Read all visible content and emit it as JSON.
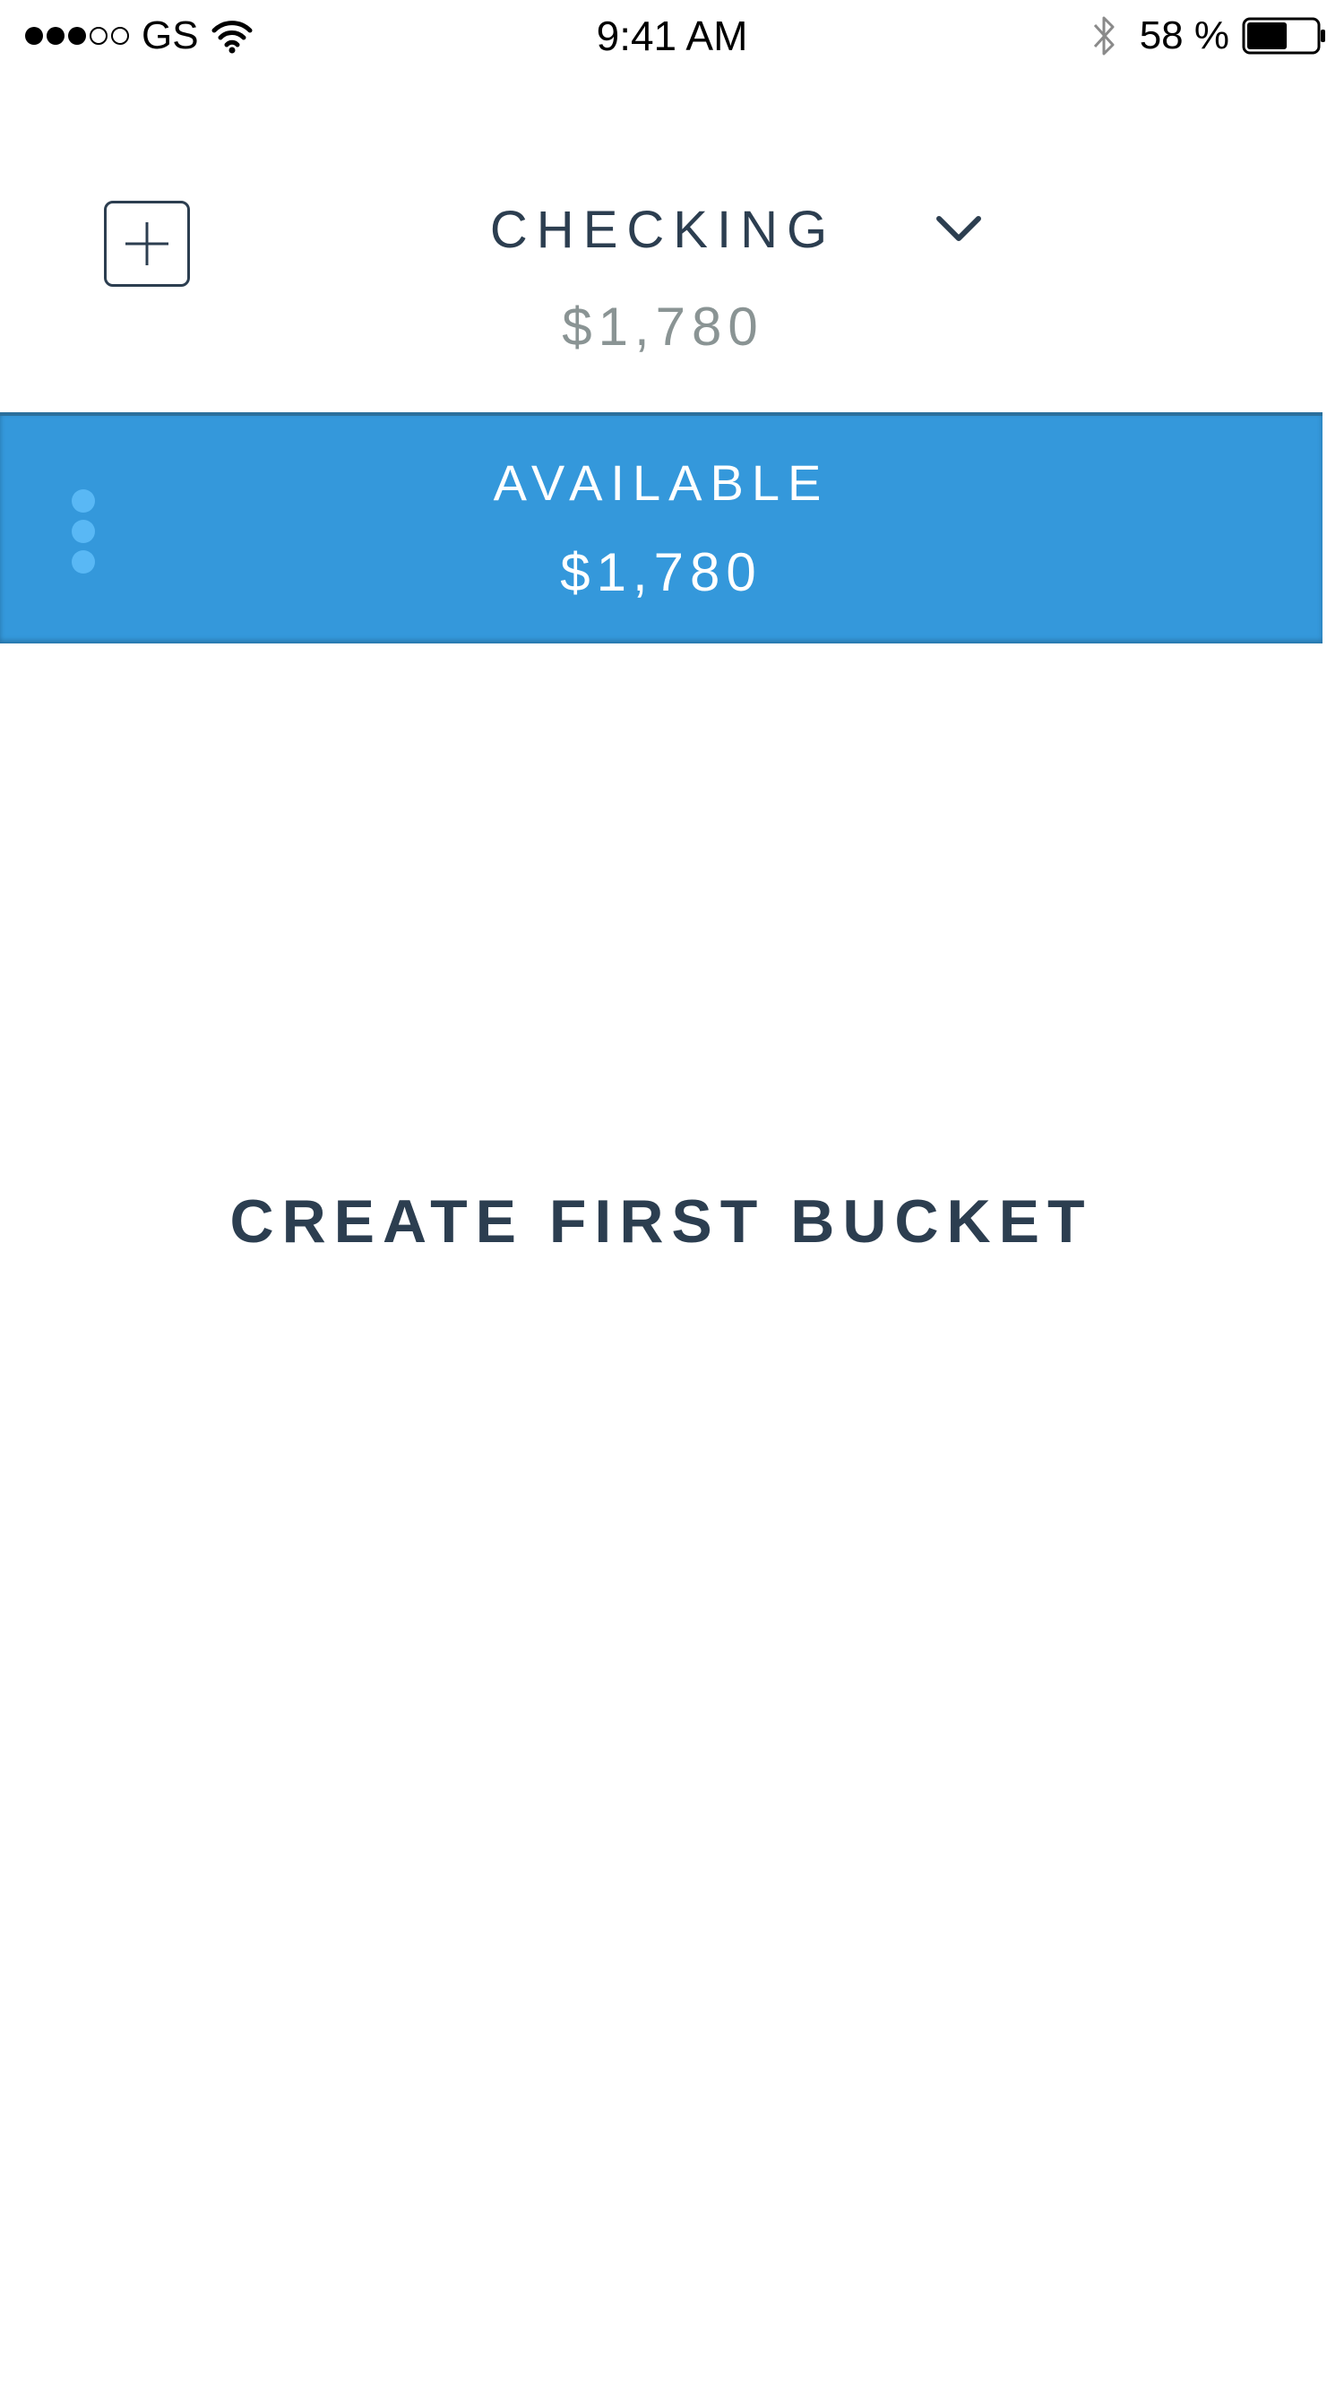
{
  "status_bar": {
    "signal": {
      "filled": 3,
      "total": 5
    },
    "carrier": "GS",
    "time": "9:41 AM",
    "battery_percent": "58 %",
    "battery_level": 0.58,
    "icons": [
      "wifi-icon",
      "bluetooth-icon",
      "battery-icon"
    ]
  },
  "header": {
    "add_icon": "plus-square-icon",
    "account_name": "CHECKING",
    "dropdown_icon": "chevron-down-icon",
    "account_balance": "$1,780"
  },
  "available": {
    "label": "AVAILABLE",
    "amount": "$1,780",
    "menu_icon": "vertical-dots-icon"
  },
  "empty_state": {
    "cta_label": "CREATE FIRST BUCKET"
  },
  "colors": {
    "primary_text": "#2c3e50",
    "muted_text": "#8a9494",
    "band_blue": "#3498db",
    "dots_blue": "#59b8f5",
    "background": "#ffffff"
  }
}
